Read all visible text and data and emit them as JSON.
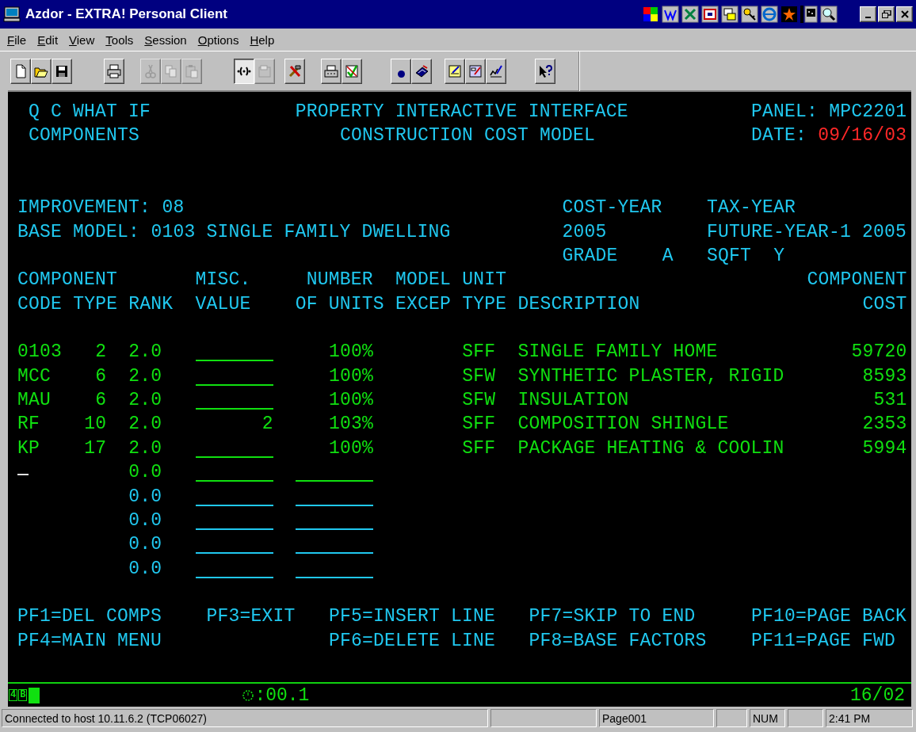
{
  "window": {
    "title": "Azdor - EXTRA! Personal Client"
  },
  "menu": [
    "File",
    "Edit",
    "View",
    "Tools",
    "Session",
    "Options",
    "Help"
  ],
  "toolbar": [
    [
      {
        "disabled": false,
        "pressed": false
      },
      {
        "disabled": false,
        "pressed": false
      },
      {
        "disabled": false,
        "pressed": false
      }
    ],
    [
      {
        "disabled": false,
        "pressed": false
      }
    ],
    [
      {
        "disabled": true,
        "pressed": false
      },
      {
        "disabled": true,
        "pressed": false
      },
      {
        "disabled": true,
        "pressed": false
      }
    ],
    [
      {
        "disabled": false,
        "pressed": true
      },
      {
        "disabled": true,
        "pressed": false
      }
    ],
    [
      {
        "disabled": false,
        "pressed": false
      }
    ],
    [
      {
        "disabled": false,
        "pressed": false
      },
      {
        "disabled": false,
        "pressed": false
      }
    ],
    [
      {
        "disabled": false,
        "pressed": false
      },
      {
        "disabled": false,
        "pressed": false
      }
    ],
    [
      {
        "disabled": false,
        "pressed": false
      },
      {
        "disabled": false,
        "pressed": false
      },
      {
        "disabled": false,
        "pressed": false
      }
    ],
    [
      {
        "disabled": false,
        "pressed": false
      }
    ]
  ],
  "screen": {
    "header": {
      "program": "Q C WHAT IF",
      "subject": "COMPONENTS",
      "system": "PROPERTY INTERACTIVE INTERFACE",
      "title": "CONSTRUCTION COST MODEL",
      "panel_label": "PANEL:",
      "panel": "MPC2201",
      "date_label": "DATE:",
      "date": "09/16/03"
    },
    "model": {
      "improvement_label": "IMPROVEMENT:",
      "improvement": "08",
      "base_model_label": "BASE MODEL:",
      "base_model": "0103 SINGLE FAMILY DWELLING",
      "cost_year_label": "COST-YEAR",
      "cost_year": "2005",
      "tax_year_label": "TAX-YEAR",
      "tax_year": "FUTURE-YEAR-1 2005",
      "grade_label": "GRADE",
      "grade": "A",
      "sqft_label": "SQFT",
      "sqft": "Y"
    },
    "headings_top": [
      "COMPONENT",
      "MISC.",
      "NUMBER",
      "MODEL",
      "UNIT",
      "COMPONENT"
    ],
    "headings_bottom": [
      "CODE",
      "TYPE",
      "RANK",
      "VALUE",
      "OF UNITS",
      "EXCEP",
      "TYPE",
      "DESCRIPTION",
      "COST"
    ],
    "rows": [
      {
        "code": "0103",
        "type": "2",
        "rank": "2.0",
        "units": "100%",
        "unit_type": "SFF",
        "description": "SINGLE FAMILY HOME",
        "cost": "59720",
        "cursor": false
      },
      {
        "code": "MCC",
        "type": "6",
        "rank": "2.0",
        "units": "100%",
        "unit_type": "SFW",
        "description": "SYNTHETIC PLASTER, RIGID",
        "cost": "8593",
        "cursor": false
      },
      {
        "code": "MAU",
        "type": "6",
        "rank": "2.0",
        "units": "100%",
        "unit_type": "SFW",
        "description": "INSULATION",
        "cost": "531",
        "cursor": false
      },
      {
        "code": "RF",
        "type": "10",
        "rank": "2.0",
        "misc_value": "2",
        "units": "103%",
        "unit_type": "SFF",
        "description": "COMPOSITION SHINGLE",
        "cost": "2353",
        "cursor": false
      },
      {
        "code": "KP",
        "type": "17",
        "rank": "2.0",
        "units": "100%",
        "unit_type": "SFF",
        "description": "PACKAGE HEATING & COOLIN",
        "cost": "5994",
        "cursor": false
      },
      {
        "rank": "0.0",
        "cursor": true
      },
      {
        "rank": "0.0",
        "cursor": false
      },
      {
        "rank": "0.0",
        "cursor": false
      },
      {
        "rank": "0.0",
        "cursor": false
      },
      {
        "rank": "0.0",
        "cursor": false
      }
    ],
    "function_keys": [
      {
        "top": "PF1=DEL COMPS",
        "bottom": "PF4=MAIN MENU"
      },
      {
        "top": "PF3=EXIT"
      },
      {
        "top": "PF5=INSERT LINE",
        "bottom": "PF6=DELETE LINE"
      },
      {
        "top": "PF7=SKIP TO END",
        "bottom": "PF8=BASE FACTORS"
      },
      {
        "top": "PF10=PAGE BACK",
        "bottom": "PF11=PAGE FWD"
      }
    ]
  },
  "oia": {
    "indicators": [
      "4",
      "B"
    ],
    "timer": ":00.1",
    "cursor_position": "16/02"
  },
  "status_bar": {
    "message": "Connected to host 10.11.6.2 (TCP06027)",
    "page": "Page001",
    "keyboard": "NUM",
    "clock": "2:41 PM"
  }
}
